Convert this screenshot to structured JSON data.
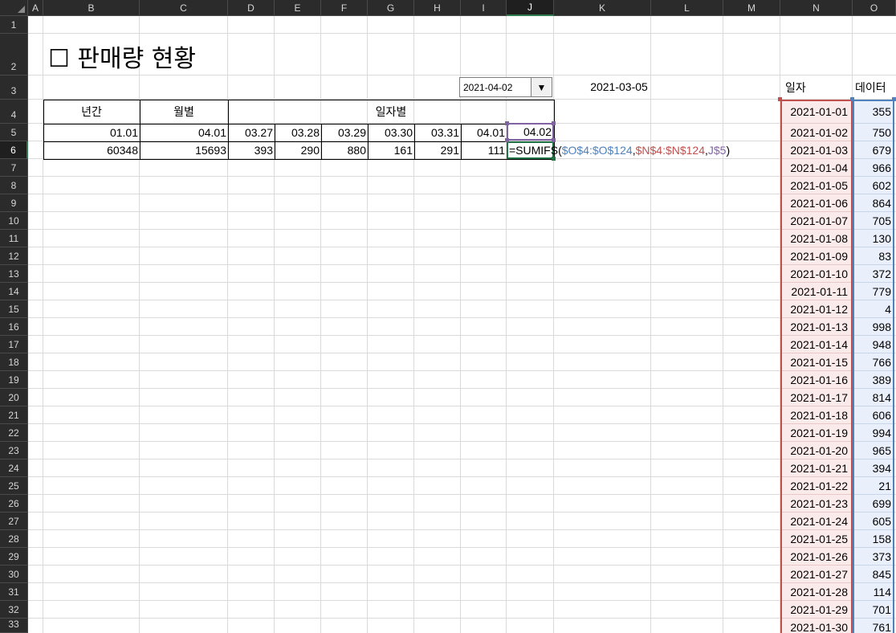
{
  "columns": [
    "A",
    "B",
    "C",
    "D",
    "E",
    "F",
    "G",
    "H",
    "I",
    "J",
    "K",
    "L",
    "M",
    "N",
    "O"
  ],
  "rows": [
    "1",
    "2",
    "3",
    "4",
    "5",
    "6",
    "7",
    "8",
    "9",
    "10",
    "11",
    "12",
    "13",
    "14",
    "15",
    "16",
    "17",
    "18",
    "19",
    "20",
    "21",
    "22",
    "23",
    "24",
    "25",
    "26",
    "27",
    "28",
    "29",
    "30",
    "31",
    "32",
    "33"
  ],
  "selected_column": "J",
  "selected_row": "6",
  "title": "☐ 판매량 현황",
  "date_dropdown": {
    "value": "2021-04-02",
    "arrow": "▼"
  },
  "reference_date": "2021-03-05",
  "summary": {
    "headers": {
      "annual": "년간",
      "monthly": "월별",
      "daily": "일자별"
    },
    "labels": {
      "annual": "01.01",
      "monthly": "04.01",
      "days": [
        "03.27",
        "03.28",
        "03.29",
        "03.30",
        "03.31",
        "04.01",
        "04.02"
      ]
    },
    "values": {
      "annual": "60348",
      "monthly": "15693",
      "days": [
        "393",
        "290",
        "880",
        "161",
        "291",
        "111"
      ]
    }
  },
  "formula_bar_edit": {
    "tokens": [
      {
        "t": "=SUMIFS(",
        "c": "d"
      },
      {
        "t": "$O$4:$O$124",
        "c": "o"
      },
      {
        "t": ",",
        "c": "d"
      },
      {
        "t": "$N$4:$N$124",
        "c": "n"
      },
      {
        "t": ",",
        "c": "d"
      },
      {
        "t": "J$5",
        "c": "j"
      },
      {
        "t": ")",
        "c": "d"
      }
    ]
  },
  "data_table": {
    "headers": {
      "date": "일자",
      "value": "데이터"
    },
    "rows": [
      {
        "date": "2021-01-01",
        "value": "355"
      },
      {
        "date": "2021-01-02",
        "value": "750"
      },
      {
        "date": "2021-01-03",
        "value": "679"
      },
      {
        "date": "2021-01-04",
        "value": "966"
      },
      {
        "date": "2021-01-05",
        "value": "602"
      },
      {
        "date": "2021-01-06",
        "value": "864"
      },
      {
        "date": "2021-01-07",
        "value": "705"
      },
      {
        "date": "2021-01-08",
        "value": "130"
      },
      {
        "date": "2021-01-09",
        "value": "83"
      },
      {
        "date": "2021-01-10",
        "value": "372"
      },
      {
        "date": "2021-01-11",
        "value": "779"
      },
      {
        "date": "2021-01-12",
        "value": "4"
      },
      {
        "date": "2021-01-13",
        "value": "998"
      },
      {
        "date": "2021-01-14",
        "value": "948"
      },
      {
        "date": "2021-01-15",
        "value": "766"
      },
      {
        "date": "2021-01-16",
        "value": "389"
      },
      {
        "date": "2021-01-17",
        "value": "814"
      },
      {
        "date": "2021-01-18",
        "value": "606"
      },
      {
        "date": "2021-01-19",
        "value": "994"
      },
      {
        "date": "2021-01-20",
        "value": "965"
      },
      {
        "date": "2021-01-21",
        "value": "394"
      },
      {
        "date": "2021-01-22",
        "value": "21"
      },
      {
        "date": "2021-01-23",
        "value": "699"
      },
      {
        "date": "2021-01-24",
        "value": "605"
      },
      {
        "date": "2021-01-25",
        "value": "158"
      },
      {
        "date": "2021-01-26",
        "value": "373"
      },
      {
        "date": "2021-01-27",
        "value": "845"
      },
      {
        "date": "2021-01-28",
        "value": "114"
      },
      {
        "date": "2021-01-29",
        "value": "701"
      },
      {
        "date": "2021-01-30",
        "value": "761"
      }
    ]
  },
  "colors": {
    "header_bg": "#2b2b2b",
    "select_green": "#217346",
    "ref_N": "#c0504d",
    "ref_O": "#4f81bd",
    "ref_J": "#8064a2"
  }
}
